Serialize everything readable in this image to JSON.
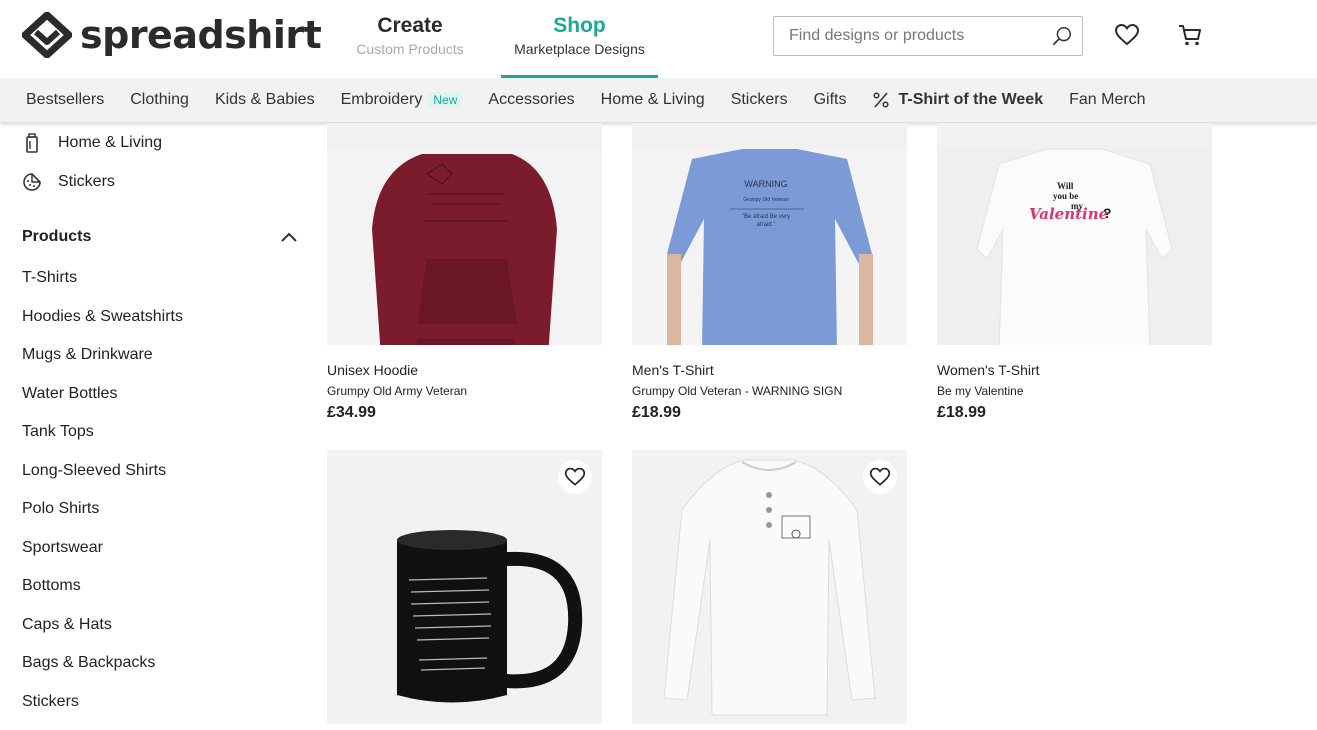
{
  "brand": {
    "name": "spreadshirt"
  },
  "modes": [
    {
      "title": "Create",
      "subtitle": "Custom Products"
    },
    {
      "title": "Shop",
      "subtitle": "Marketplace Designs"
    }
  ],
  "search": {
    "placeholder": "Find designs or products"
  },
  "nav": {
    "items": [
      "Bestsellers",
      "Clothing",
      "Kids & Babies",
      "Embroidery",
      "Accessories",
      "Home & Living",
      "Stickers",
      "Gifts",
      "T-Shirt of the Week",
      "Fan Merch"
    ],
    "badge": "New"
  },
  "sidebar": {
    "categories": [
      {
        "label": "Home & Living",
        "icon": "home-living-icon"
      },
      {
        "label": "Stickers",
        "icon": "sticker-icon"
      }
    ],
    "products_heading": "Products",
    "products": [
      "T-Shirts",
      "Hoodies & Sweatshirts",
      "Mugs & Drinkware",
      "Water Bottles",
      "Tank Tops",
      "Long-Sleeved Shirts",
      "Polo Shirts",
      "Sportswear",
      "Bottoms",
      "Caps & Hats",
      "Bags & Backpacks",
      "Stickers"
    ]
  },
  "products": [
    {
      "type": "Unisex Hoodie",
      "name": "Grumpy Old Army Veteran",
      "price": "£34.99",
      "color": "#7a1c2c"
    },
    {
      "type": "Men's T-Shirt",
      "name": "Grumpy Old Veteran - WARNING SIGN",
      "price": "£18.99",
      "color": "#7b9ad6"
    },
    {
      "type": "Women's T-Shirt",
      "name": "Be my Valentine",
      "price": "£18.99",
      "color": "#f7f7f7"
    },
    {
      "type": "",
      "name": "",
      "price": "",
      "color": "#111111"
    },
    {
      "type": "",
      "name": "",
      "price": "",
      "color": "#f2f2f2"
    }
  ],
  "print_text": {
    "warning": "WARNING",
    "veteran": "Grumpy Old Veteran",
    "afraid_1": "\"Be afraid Be very",
    "afraid_2": "afraid.\"",
    "will": "Will",
    "you_be": "you be",
    "my": "my",
    "valentine": "Valentine",
    "question": "?"
  },
  "colors": {
    "accent": "#18a999",
    "text": "#222222"
  }
}
